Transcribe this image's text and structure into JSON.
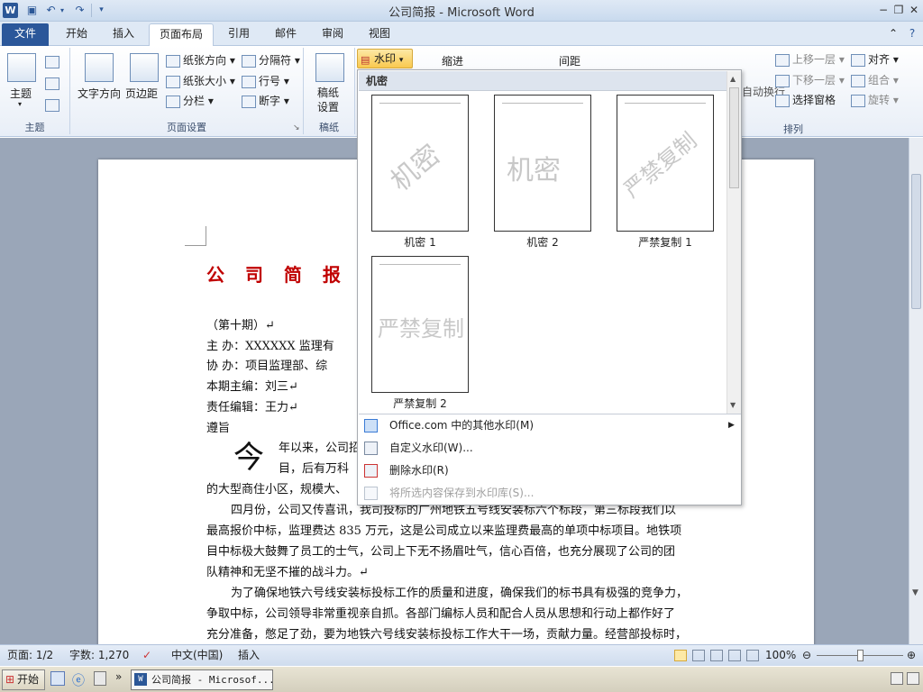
{
  "app": {
    "title": "公司简报  -  Microsoft Word",
    "logo": "W"
  },
  "window_controls": {
    "min": "−",
    "restore": "❐",
    "close": "✕"
  },
  "tabs": [
    {
      "label": "文件"
    },
    {
      "label": "开始"
    },
    {
      "label": "插入"
    },
    {
      "label": "页面布局"
    },
    {
      "label": "引用"
    },
    {
      "label": "邮件"
    },
    {
      "label": "审阅"
    },
    {
      "label": "视图"
    }
  ],
  "ribbon": {
    "theme_group": {
      "label": "主题",
      "theme_btn": "主题"
    },
    "page_setup": {
      "label": "页面设置",
      "text_direction": "文字方向",
      "margins": "页边距",
      "orientation": "纸张方向",
      "size": "纸张大小",
      "columns": "分栏",
      "breaks": "分隔符",
      "line_numbers": "行号",
      "hyphenation": "断字"
    },
    "draft": {
      "label": "稿纸",
      "btn": "稿纸\n设置"
    },
    "watermark_btn": "水印",
    "indent": "缩进",
    "spacing": "间距",
    "arrange": {
      "label": "排列",
      "wrap": "自动换行",
      "bring_forward": "上移一层",
      "send_backward": "下移一层",
      "selection_pane": "选择窗格",
      "align": "对齐",
      "group": "组合",
      "rotate": "旋转"
    }
  },
  "gallery": {
    "header": "机密",
    "items": [
      {
        "caption": "机密 1",
        "text": "机密"
      },
      {
        "caption": "机密 2",
        "text": "机密"
      },
      {
        "caption": "严禁复制 1",
        "text": "严禁复制"
      },
      {
        "caption": "严禁复制 2",
        "text": "严禁复制"
      }
    ],
    "menu": [
      {
        "label": "Office.com 中的其他水印(M)",
        "enabled": true
      },
      {
        "label": "自定义水印(W)...",
        "enabled": true
      },
      {
        "label": "删除水印(R)",
        "enabled": true
      },
      {
        "label": "将所选内容保存到水印库(S)...",
        "enabled": false
      }
    ]
  },
  "document": {
    "title": "公 司 简 报",
    "issue": "（第十期）↵",
    "sponsor_label": "主      办：",
    "sponsor_value": "XXXXXX 监理有",
    "co_sponsor_label": "协      办：",
    "co_sponsor_value": "项目监理部、综",
    "editor_in_chief": "本期主编：刘三↵",
    "editor": "责任编辑：王力↵",
    "motto": "遵旨",
    "drop_cap": "今",
    "para1_line1": "年以来，公司招",
    "para1_line2": "目，后有万科",
    "para1_line3": "的大型商住小区，规模大、",
    "para2_line1": "四月份，公司又传喜讯，我司投标的广州地铁五号线安装标六个标段，第三标段我们以",
    "para2_line2": "最高报价中标，监理费达 835 万元，这是公司成立以来监理费最高的单项中标项目。地铁项",
    "para2_line3": "目中标极大鼓舞了员工的士气，公司上下无不扬眉吐气，信心百倍，也充分展现了公司的团",
    "para2_line4": "队精神和无坚不摧的战斗力。↵",
    "para3_line1": "为了确保地铁六号线安装标投标工作的质量和进度，确保我们的标书具有极强的竞争力，",
    "para3_line2": "争取中标，公司领导非常重视亲自抓。各部门编标人员和配合人员从思想和行动上都作好了",
    "para3_line3": "充分准备，憋足了劲，要为地铁六号线安装标投标工作大干一场，贡献力量。经营部投标时，"
  },
  "status": {
    "page": "页面: 1/2",
    "words": "字数: 1,270",
    "language": "中文(中国)",
    "insert": "插入",
    "zoom": "100%"
  },
  "taskbar": {
    "start": "开始",
    "task": "公司简报 - Microsof..."
  }
}
